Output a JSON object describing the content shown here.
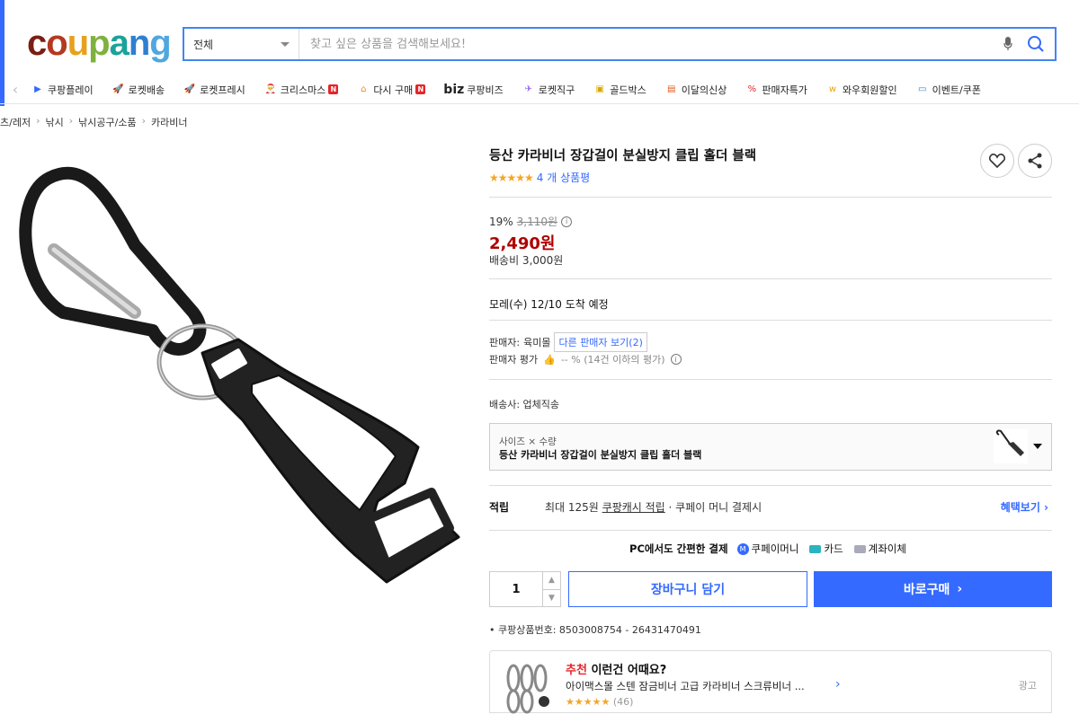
{
  "header": {
    "logo_letters": [
      "c",
      "o",
      "u",
      "p",
      "a",
      "n",
      "g"
    ],
    "logo_colors": [
      "#7a1e13",
      "#b4391f",
      "#e6a21d",
      "#7eb13d",
      "#1aa39a",
      "#2f7fd0",
      "#4fa7e0"
    ],
    "search": {
      "category": "전체",
      "placeholder": "찾고 싶은 상품을 검색해보세요!"
    }
  },
  "nav": {
    "items": [
      {
        "label": "쿠팡플레이",
        "icon": "play-icon"
      },
      {
        "label": "로켓배송",
        "icon": "rocket-icon"
      },
      {
        "label": "로켓프레시",
        "icon": "rocket-fresh-icon"
      },
      {
        "label": "크리스마스",
        "icon": "santa-icon",
        "badge": "N"
      },
      {
        "label": "다시 구매",
        "icon": "repurchase-icon",
        "badge": "N"
      },
      {
        "label": "쿠팡비즈",
        "icon": "biz-icon",
        "prefix": "biz"
      },
      {
        "label": "로켓직구",
        "icon": "global-icon"
      },
      {
        "label": "골드박스",
        "icon": "goldbox-icon"
      },
      {
        "label": "이달의신상",
        "icon": "new-bag-icon"
      },
      {
        "label": "판매자특가",
        "icon": "percent-icon"
      },
      {
        "label": "와우회원할인",
        "icon": "wow-icon"
      },
      {
        "label": "이벤트/쿠폰",
        "icon": "coupon-icon"
      }
    ]
  },
  "breadcrumb": [
    "츠/레저",
    "낚시",
    "낚시공구/소품",
    "카라비너"
  ],
  "product": {
    "title": "등산 카라비너 장갑걸이 분실방지 클립 홀더 블랙",
    "stars": "★★★★★",
    "review_count": "4 개 상품평",
    "discount_rate": "19%",
    "original_price": "3,110원",
    "price": "2,490원",
    "shipping": "배송비 3,000원",
    "delivery": "모레(수) 12/10 도착 예정",
    "seller_label": "판매자:",
    "seller_name": "육미몰",
    "other_sellers": "다른 판매자 보기(2)",
    "seller_rating_label": "판매자 평가",
    "seller_rating_value": "-- % (14건 이하의 평가)",
    "ship_company": "배송사:  업체직송",
    "option_label": "사이즈 × 수량",
    "option_value": "등산 카라비너 장갑걸이 분실방지 클립 홀더 블랙",
    "points_label": "적립",
    "points_text1": "최대 125원 ",
    "points_text2": "쿠팡캐시 적립",
    "points_text3": " · 쿠페이 머니 결제시",
    "benefit": "혜택보기 ›",
    "payment_title": "PC에서도 간편한 결제",
    "payment_methods": [
      "쿠페이머니",
      "카드",
      "계좌이체"
    ],
    "quantity": "1",
    "cart_label": "장바구니 담기",
    "buy_label": "바로구매",
    "product_id": "쿠팡상품번호: 8503008754 - 26431470491"
  },
  "recommend": {
    "head_red": "추천",
    "head_rest": " 이런건 어때요?",
    "name": "아이맥스몰 스텐 잠금비너 고급 카라비너 스크류비너 ...",
    "stars": "★★★★★",
    "count": "(46)",
    "ad": "광고"
  }
}
